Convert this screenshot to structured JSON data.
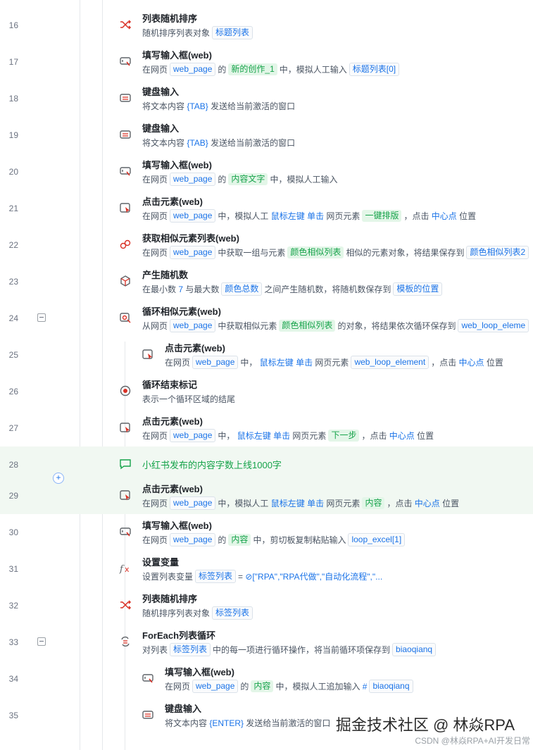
{
  "rows": [
    {
      "num": "16",
      "title": "列表随机排序",
      "parts": [
        {
          "t": "随机排序列表对象"
        },
        {
          "t": "标题列表",
          "s": "tag"
        }
      ]
    },
    {
      "num": "17",
      "title": "填写输入框(web)",
      "parts": [
        {
          "t": "在网页"
        },
        {
          "t": "web_page",
          "s": "tag"
        },
        {
          "t": "的"
        },
        {
          "t": "新的创作_1",
          "s": "green"
        },
        {
          "t": "中，模拟人工输入"
        },
        {
          "t": "标题列表[0]",
          "s": "tag"
        }
      ]
    },
    {
      "num": "18",
      "title": "键盘输入",
      "parts": [
        {
          "t": "将文本内容 "
        },
        {
          "t": "{TAB}",
          "s": "blue"
        },
        {
          "t": " 发送给当前激活的窗口"
        }
      ]
    },
    {
      "num": "19",
      "title": "键盘输入",
      "parts": [
        {
          "t": "将文本内容 "
        },
        {
          "t": "{TAB}",
          "s": "blue"
        },
        {
          "t": " 发送给当前激活的窗口"
        }
      ]
    },
    {
      "num": "20",
      "title": "填写输入框(web)",
      "parts": [
        {
          "t": "在网页"
        },
        {
          "t": "web_page",
          "s": "tag"
        },
        {
          "t": "的"
        },
        {
          "t": "内容文字",
          "s": "green"
        },
        {
          "t": "中，模拟人工输入"
        }
      ]
    },
    {
      "num": "21",
      "title": "点击元素(web)",
      "parts": [
        {
          "t": "在网页"
        },
        {
          "t": "web_page",
          "s": "tag"
        },
        {
          "t": "中，模拟人工 "
        },
        {
          "t": "鼠标左键 单击",
          "s": "blue"
        },
        {
          "t": " 网页元素"
        },
        {
          "t": "一键排版",
          "s": "green"
        },
        {
          "t": "，点击 "
        },
        {
          "t": "中心点",
          "s": "blue"
        },
        {
          "t": " 位置"
        }
      ]
    },
    {
      "num": "22",
      "title": "获取相似元素列表(web)",
      "parts": [
        {
          "t": "在网页"
        },
        {
          "t": "web_page",
          "s": "tag"
        },
        {
          "t": "中获取一组与元素"
        },
        {
          "t": "颜色相似列表",
          "s": "green"
        },
        {
          "t": "相似的元素对象，将结果保存到"
        },
        {
          "t": "颜色相似列表2",
          "s": "tag"
        }
      ]
    },
    {
      "num": "23",
      "title": "产生随机数",
      "parts": [
        {
          "t": "在最小数 "
        },
        {
          "t": "7",
          "s": "blue"
        },
        {
          "t": " 与最大数"
        },
        {
          "t": "颜色总数",
          "s": "tag"
        },
        {
          "t": "之间产生随机数，将随机数保存到"
        },
        {
          "t": "模板的位置",
          "s": "tag"
        }
      ]
    },
    {
      "num": "24",
      "title": "循环相似元素(web)",
      "parts": [
        {
          "t": "从网页"
        },
        {
          "t": "web_page",
          "s": "tag"
        },
        {
          "t": "中获取相似元素"
        },
        {
          "t": "颜色相似列表",
          "s": "green"
        },
        {
          "t": "的对象，将结果依次循环保存到"
        },
        {
          "t": "web_loop_eleme",
          "s": "tag"
        }
      ]
    },
    {
      "num": "25",
      "title": "点击元素(web)",
      "parts": [
        {
          "t": "在网页"
        },
        {
          "t": "web_page",
          "s": "tag"
        },
        {
          "t": "中，  "
        },
        {
          "t": "鼠标左键 单击",
          "s": "blue"
        },
        {
          "t": " 网页元素"
        },
        {
          "t": "web_loop_element",
          "s": "tag"
        },
        {
          "t": "，点击 "
        },
        {
          "t": "中心点",
          "s": "blue"
        },
        {
          "t": " 位置"
        }
      ]
    },
    {
      "num": "26",
      "title": "循环结束标记",
      "parts": [
        {
          "t": "表示一个循环区域的结尾"
        }
      ]
    },
    {
      "num": "27",
      "title": "点击元素(web)",
      "parts": [
        {
          "t": "在网页"
        },
        {
          "t": "web_page",
          "s": "tag"
        },
        {
          "t": "中，  "
        },
        {
          "t": "鼠标左键 单击",
          "s": "blue"
        },
        {
          "t": " 网页元素"
        },
        {
          "t": "下一步",
          "s": "green"
        },
        {
          "t": "，点击 "
        },
        {
          "t": "中心点",
          "s": "blue"
        },
        {
          "t": " 位置"
        }
      ]
    },
    {
      "num": "28",
      "comment": "小红书发布的内容字数上线1000字"
    },
    {
      "num": "29",
      "title": "点击元素(web)",
      "parts": [
        {
          "t": "在网页"
        },
        {
          "t": "web_page",
          "s": "tag"
        },
        {
          "t": "中，模拟人工 "
        },
        {
          "t": "鼠标左键 单击",
          "s": "blue"
        },
        {
          "t": " 网页元素"
        },
        {
          "t": "内容",
          "s": "green"
        },
        {
          "t": "，点击 "
        },
        {
          "t": "中心点",
          "s": "blue"
        },
        {
          "t": " 位置"
        }
      ]
    },
    {
      "num": "30",
      "title": "填写输入框(web)",
      "parts": [
        {
          "t": "在网页"
        },
        {
          "t": "web_page",
          "s": "tag"
        },
        {
          "t": "的"
        },
        {
          "t": "内容",
          "s": "green"
        },
        {
          "t": "中，剪切板复制粘贴输入"
        },
        {
          "t": "loop_excel[1]",
          "s": "tag"
        }
      ]
    },
    {
      "num": "31",
      "title": "设置变量",
      "parts": [
        {
          "t": "设置列表变量"
        },
        {
          "t": "标签列表",
          "s": "tag"
        },
        {
          "t": "= "
        },
        {
          "t": "⊘[\"RPA\",\"RPA代做\",\"自动化流程\",\"...",
          "s": "blue"
        }
      ]
    },
    {
      "num": "32",
      "title": "列表随机排序",
      "parts": [
        {
          "t": "随机排序列表对象"
        },
        {
          "t": "标签列表",
          "s": "tag"
        }
      ]
    },
    {
      "num": "33",
      "title": "ForEach列表循环",
      "parts": [
        {
          "t": "对列表"
        },
        {
          "t": "标签列表",
          "s": "tag"
        },
        {
          "t": "中的每一项进行循环操作，将当前循环项保存到"
        },
        {
          "t": "biaoqianq",
          "s": "tag"
        }
      ]
    },
    {
      "num": "34",
      "title": "填写输入框(web)",
      "parts": [
        {
          "t": "在网页"
        },
        {
          "t": "web_page",
          "s": "tag"
        },
        {
          "t": "的"
        },
        {
          "t": "内容",
          "s": "green"
        },
        {
          "t": "中，模拟人工追加输入 "
        },
        {
          "t": "#",
          "s": "blue"
        },
        {
          "t": "biaoqianq",
          "s": "tag"
        }
      ]
    },
    {
      "num": "35",
      "title": "键盘输入",
      "parts": [
        {
          "t": "将文本内容 "
        },
        {
          "t": "{ENTER}",
          "s": "blue"
        },
        {
          "t": " 发送给当前激活的窗口"
        }
      ]
    }
  ],
  "watermark": "掘金技术社区 @ 林焱RPA",
  "csdn_mark": "CSDN @林焱RPA+AI开发日常",
  "colors": {
    "accent": "#1a73e8",
    "green": "#16a34a",
    "highlight": "#f1f8f2"
  }
}
